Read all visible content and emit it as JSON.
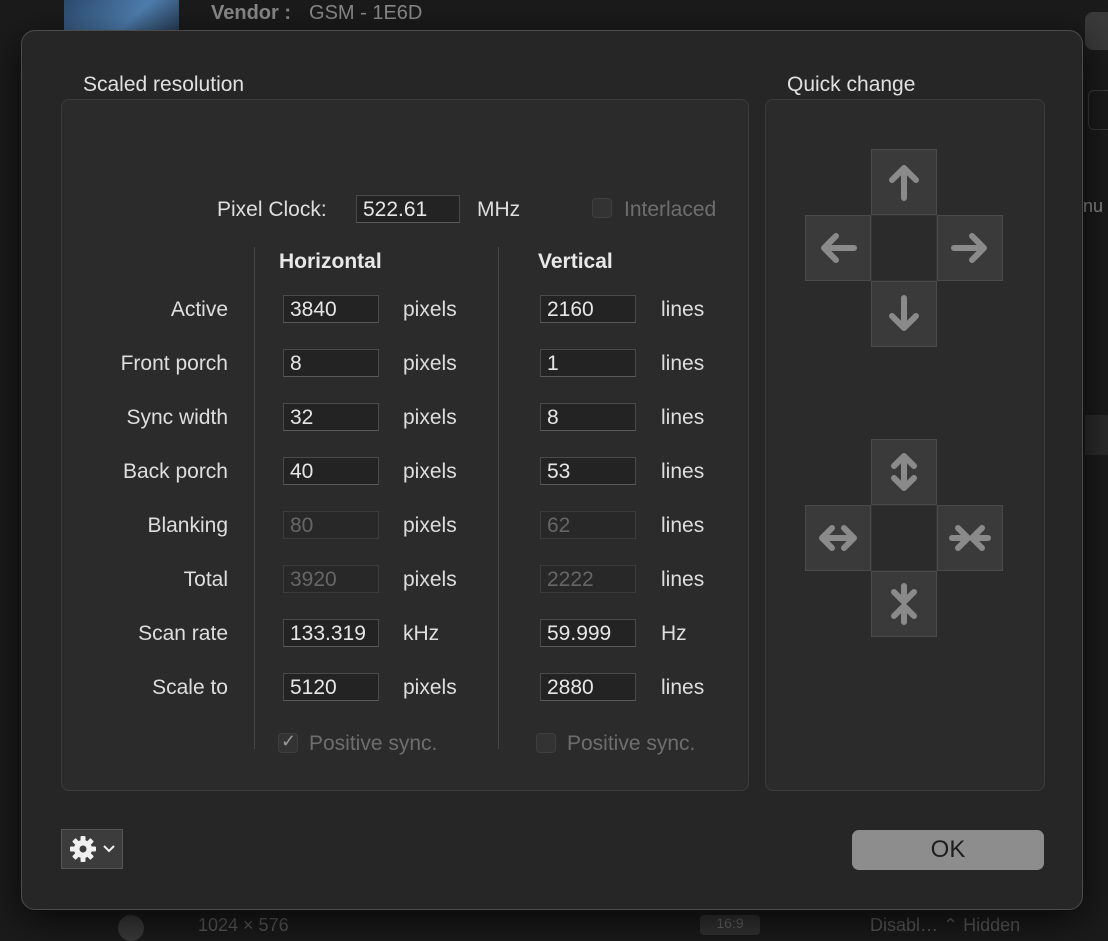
{
  "background": {
    "vendor_label": "Vendor :",
    "vendor_value": "GSM - 1E6D",
    "side_text": "nu",
    "bottom_res": "1024 × 576",
    "bottom_badge": "16:9",
    "bottom_text": "Disabl… ⌃ Hidden"
  },
  "scaled": {
    "title": "Scaled resolution",
    "pixel_clock_label": "Pixel Clock:",
    "pixel_clock_value": "522.61",
    "pixel_clock_unit": "MHz",
    "interlaced_label": "Interlaced",
    "interlaced_checked": false,
    "horizontal_header": "Horizontal",
    "vertical_header": "Vertical",
    "rows": [
      {
        "label": "Active",
        "h": "3840",
        "h_unit": "pixels",
        "v": "2160",
        "v_unit": "lines",
        "editable": true
      },
      {
        "label": "Front porch",
        "h": "8",
        "h_unit": "pixels",
        "v": "1",
        "v_unit": "lines",
        "editable": true
      },
      {
        "label": "Sync width",
        "h": "32",
        "h_unit": "pixels",
        "v": "8",
        "v_unit": "lines",
        "editable": true
      },
      {
        "label": "Back porch",
        "h": "40",
        "h_unit": "pixels",
        "v": "53",
        "v_unit": "lines",
        "editable": true
      },
      {
        "label": "Blanking",
        "h": "80",
        "h_unit": "pixels",
        "v": "62",
        "v_unit": "lines",
        "editable": false
      },
      {
        "label": "Total",
        "h": "3920",
        "h_unit": "pixels",
        "v": "2222",
        "v_unit": "lines",
        "editable": false
      },
      {
        "label": "Scan rate",
        "h": "133.319",
        "h_unit": "kHz",
        "v": "59.999",
        "v_unit": "Hz",
        "editable": true
      },
      {
        "label": "Scale to",
        "h": "5120",
        "h_unit": "pixels",
        "v": "2880",
        "v_unit": "lines",
        "editable": true
      }
    ],
    "h_positive_sync_label": "Positive sync.",
    "h_positive_sync_checked": true,
    "v_positive_sync_label": "Positive sync.",
    "v_positive_sync_checked": false
  },
  "quick": {
    "title": "Quick change",
    "move_icons": [
      "arrow-up-icon",
      "arrow-left-icon",
      "arrow-right-icon",
      "arrow-down-icon"
    ],
    "resize_icons": [
      "expand-vertical-icon",
      "expand-horizontal-icon",
      "shrink-horizontal-icon",
      "shrink-vertical-icon"
    ]
  },
  "footer": {
    "ok_label": "OK",
    "gear_icon": "gear-icon"
  },
  "colors": {
    "dialog_bg": "#262626",
    "ok_button": "#8d8d8d"
  }
}
